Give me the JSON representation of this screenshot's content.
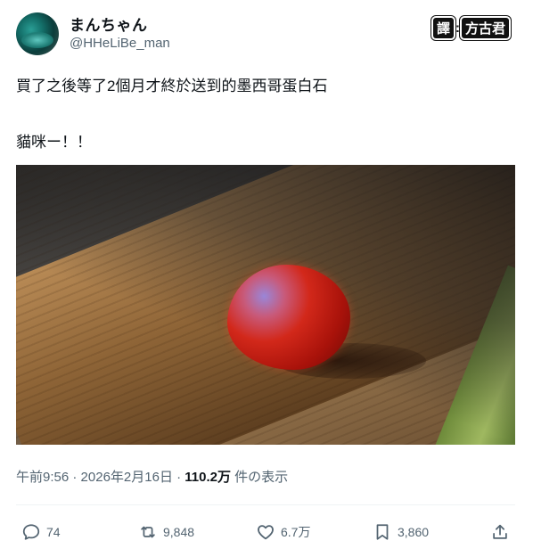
{
  "author": {
    "display_name": "まんちゃん",
    "handle": "@HHeLiBe_man"
  },
  "watermark": {
    "left": "譯",
    "sep": "",
    "right": "方古君"
  },
  "tweet": {
    "line1": "買了之後等了2個月才終於送到的墨西哥蛋白石",
    "line2": "貓咪ー！！"
  },
  "meta": {
    "time": "午前9:56",
    "dot1": " · ",
    "date": "2026年2月16日",
    "dot2": " · ",
    "views": "110.2万",
    "views_label": " 件の表示"
  },
  "actions": {
    "reply_count": "74",
    "retweet_count": "9,848",
    "like_count": "6.7万",
    "bookmark_count": "3,860"
  },
  "colors": {
    "text": "#0f1419",
    "secondary": "#536471",
    "divider": "#eff3f4"
  }
}
